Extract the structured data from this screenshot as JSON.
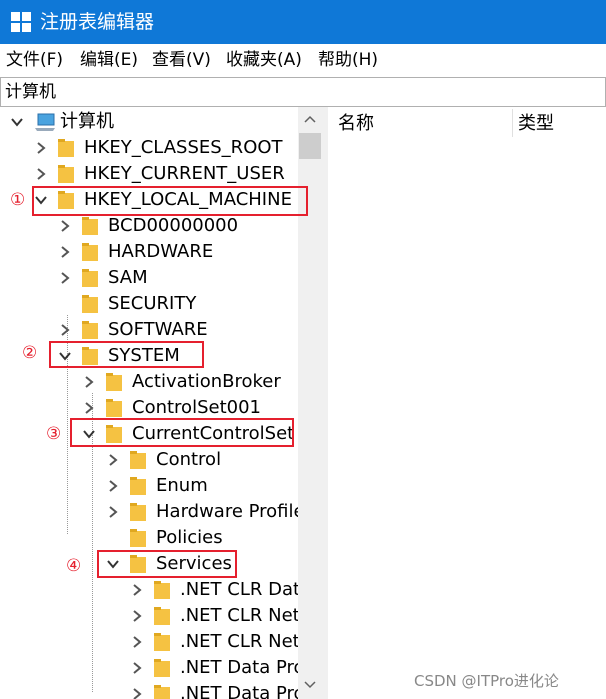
{
  "window": {
    "title": "注册表编辑器"
  },
  "menu": [
    "文件(F)",
    "编辑(E)",
    "查看(V)",
    "收藏夹(A)",
    "帮助(H)"
  ],
  "address": "计算机",
  "tree": {
    "root": "计算机",
    "hives": [
      "HKEY_CLASSES_ROOT",
      "HKEY_CURRENT_USER",
      "HKEY_LOCAL_MACHINE"
    ],
    "hklm_children": [
      "BCD00000000",
      "HARDWARE",
      "SAM",
      "SECURITY",
      "SOFTWARE",
      "SYSTEM"
    ],
    "system_children": [
      "ActivationBroker",
      "ControlSet001",
      "CurrentControlSet"
    ],
    "ccs_children": [
      "Control",
      "Enum",
      "Hardware Profile",
      "Policies",
      "Services"
    ],
    "services_children": [
      ".NET CLR Data",
      ".NET CLR Netw",
      ".NET CLR Netw",
      ".NET Data Pro",
      ".NET Data Pro"
    ]
  },
  "columns": {
    "name": "名称",
    "type": "类型"
  },
  "markers": [
    "①",
    "②",
    "③",
    "④"
  ],
  "watermark": "CSDN @ITPro进化论",
  "colors": {
    "titlebar": "#0f78d7",
    "highlight": "#e5202e",
    "folder": "#f5c242"
  }
}
